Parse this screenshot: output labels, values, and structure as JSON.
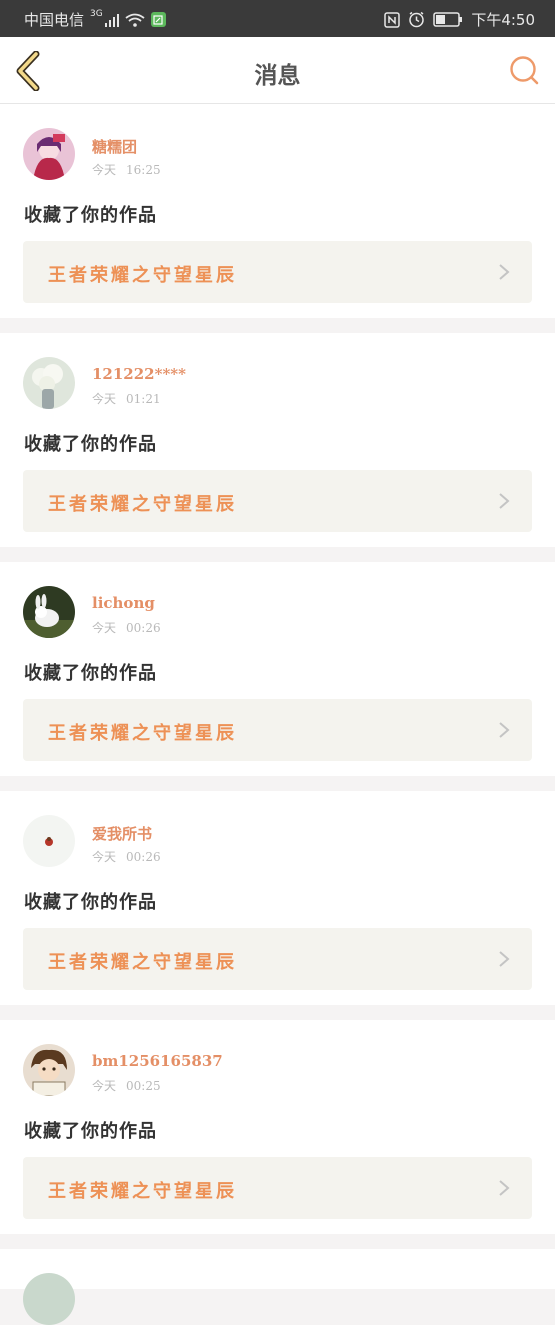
{
  "status_bar": {
    "carrier": "中国电信",
    "network": "3G",
    "time": "下午4:50"
  },
  "header": {
    "title": "消息",
    "back_icon": "chevron-left-icon",
    "search_icon": "search-icon"
  },
  "colors": {
    "accent": "#e48f66",
    "work_title": "#ed9156",
    "card_bg": "#f4f3ee",
    "page_bg": "#f5f3f3"
  },
  "messages": [
    {
      "username": "糖糯团",
      "day": "今天",
      "time": "16:25",
      "action": "收藏了你的作品",
      "work_title": "王者荣耀之守望星辰"
    },
    {
      "username": "121222****",
      "day": "今天",
      "time": "01:21",
      "action": "收藏了你的作品",
      "work_title": "王者荣耀之守望星辰"
    },
    {
      "username": "lichong",
      "day": "今天",
      "time": "00:26",
      "action": "收藏了你的作品",
      "work_title": "王者荣耀之守望星辰"
    },
    {
      "username": "爱我所书",
      "day": "今天",
      "time": "00:26",
      "action": "收藏了你的作品",
      "work_title": "王者荣耀之守望星辰"
    },
    {
      "username": "bm1256165837",
      "day": "今天",
      "time": "00:25",
      "action": "收藏了你的作品",
      "work_title": "王者荣耀之守望星辰"
    }
  ]
}
